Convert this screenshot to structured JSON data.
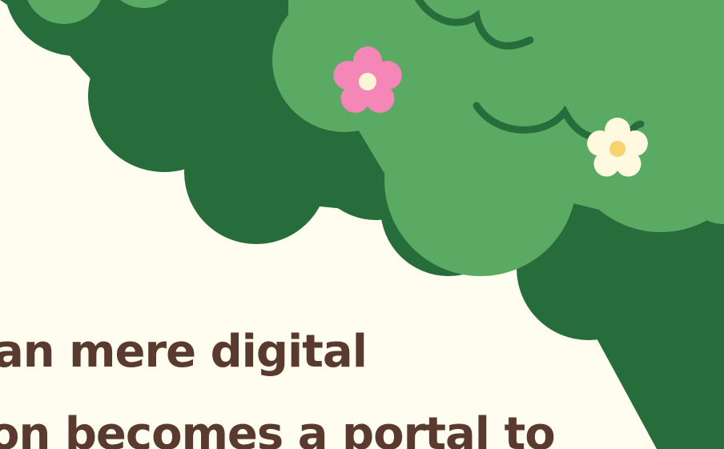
{
  "text": {
    "line1": "an mere digital",
    "line2": "on becomes a portal to"
  },
  "colors": {
    "background": "#FEFDF0",
    "foliage_dark": "#276D3B",
    "foliage_light": "#5BAA64",
    "text": "#5A3A2E",
    "flower_pink": "#F487B7",
    "flower_cream": "#FFF9DF",
    "flower_center_yellow": "#F8D26E"
  },
  "decorations": {
    "flowers": [
      "pink-flower",
      "cream-flower"
    ],
    "icon_names": [
      "bush-foliage",
      "flower-icon"
    ]
  }
}
